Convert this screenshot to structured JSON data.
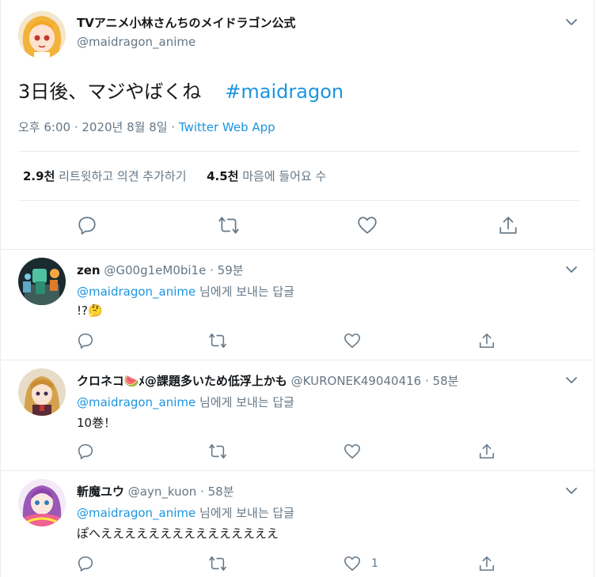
{
  "main_tweet": {
    "display_name": "TVアニメ小林さんちのメイドラゴン公式",
    "handle": "@maidragon_anime",
    "text": "3日後、マジやばくね",
    "hashtag": "#maidragon",
    "timestamp": "오후 6:00 · 2020년 8월 8일",
    "source_sep": " · ",
    "source": "Twitter Web App",
    "retweet_count": "2.9천",
    "retweet_label": "리트윗하고 의견 추가하기",
    "like_count": "4.5천",
    "like_label": "마음에 들어요 수"
  },
  "replies": [
    {
      "display_name": "zen",
      "handle": "@G00g1eM0bi1e",
      "time": "· 59분",
      "mention": "@maidragon_anime",
      "reply_to_label": "님에게 보내는 답글",
      "text": "!?🤔",
      "like_count": ""
    },
    {
      "display_name": "クロネコ🍉ﾒ@課題多いため低浮上かも",
      "handle": "@KURONEK49040416",
      "time": "· 58분",
      "mention": "@maidragon_anime",
      "reply_to_label": "님에게 보내는 답글",
      "text": "10巻！",
      "like_count": ""
    },
    {
      "display_name": "斬魔ユウ",
      "handle": "@ayn_kuon",
      "time": "· 58분",
      "mention": "@maidragon_anime",
      "reply_to_label": "님에게 보내는 답글",
      "text": "ぽへえええええええええええええええ",
      "like_count": "1"
    }
  ],
  "colors": {
    "accent": "#1b95e0",
    "muted": "#657786",
    "divider": "#e6ecf0"
  }
}
